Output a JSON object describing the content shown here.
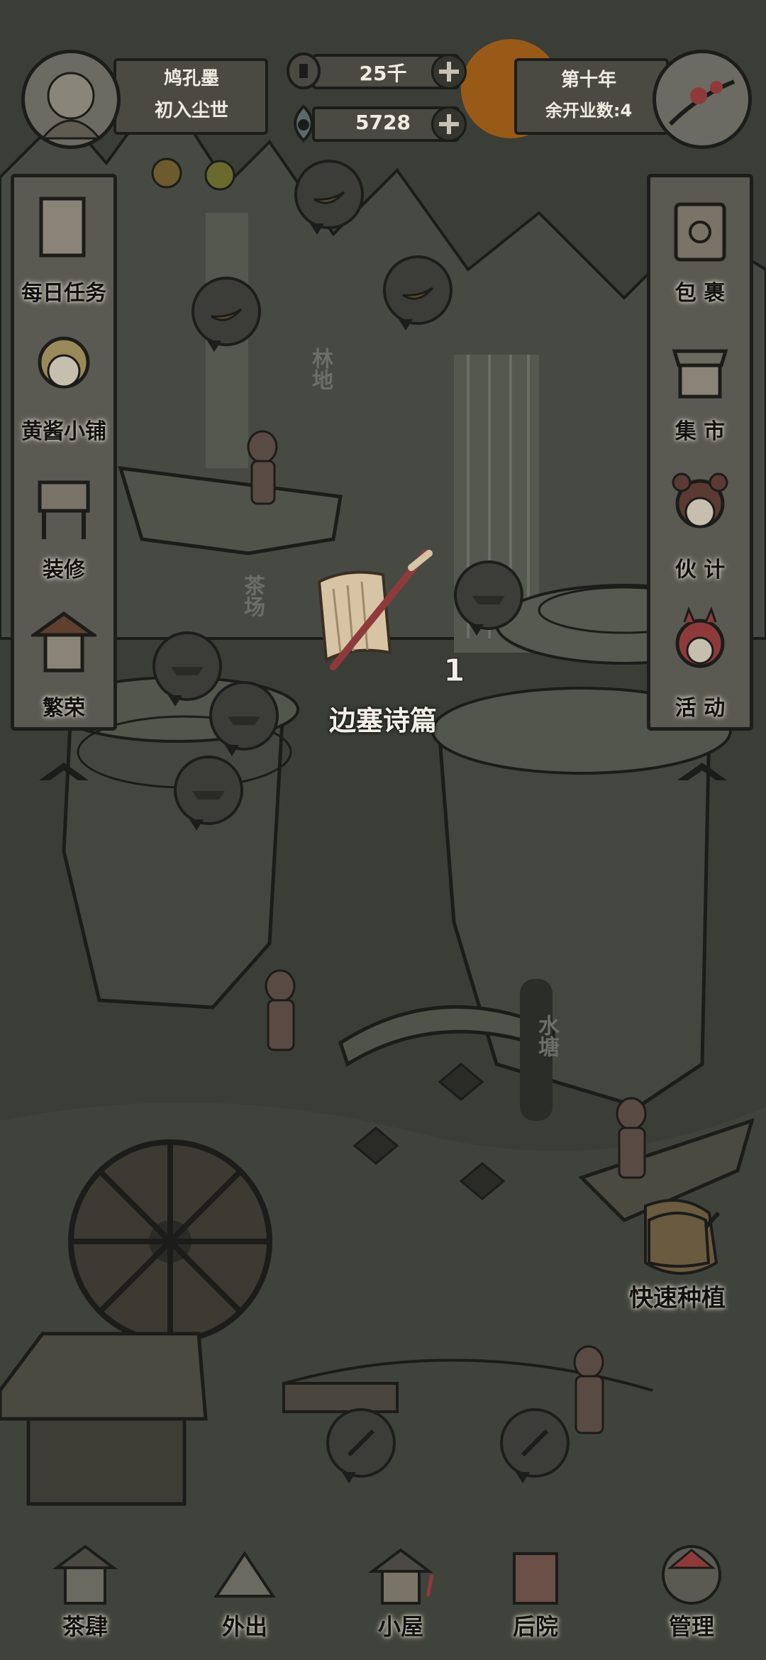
{
  "player": {
    "name": "鸠孔墨",
    "title": "初入尘世"
  },
  "currency": {
    "coins": "25千",
    "gems": "5728"
  },
  "year": {
    "label": "第十年",
    "remaining": "余开业数:4"
  },
  "left_menu": [
    {
      "label": "每日任务",
      "icon": "task-scroll-icon"
    },
    {
      "label": "黄酱小铺",
      "icon": "shop-girl-icon"
    },
    {
      "label": "装修",
      "icon": "furniture-icon"
    },
    {
      "label": "繁荣",
      "icon": "prosperity-icon"
    }
  ],
  "right_menu": [
    {
      "label": "包 裹",
      "icon": "bag-icon"
    },
    {
      "label": "集 市",
      "icon": "market-icon"
    },
    {
      "label": "伙 计",
      "icon": "clerk-icon"
    },
    {
      "label": "活 动",
      "icon": "event-icon"
    }
  ],
  "zones": {
    "forest": "林地",
    "tea_field": "茶场",
    "pond": "水塘"
  },
  "event": {
    "count": "1",
    "title": "边塞诗篇"
  },
  "quick_plant": "快速种植",
  "bottom_nav": [
    {
      "label": "茶肆",
      "icon": "teahouse-icon"
    },
    {
      "label": "外出",
      "icon": "outing-icon"
    },
    {
      "label": "小屋",
      "icon": "cottage-icon"
    },
    {
      "label": "后院",
      "icon": "backyard-icon"
    },
    {
      "label": "管理",
      "icon": "manage-icon"
    }
  ],
  "colors": {
    "background": "#3a3d36",
    "ink": "#1c1c1a",
    "sun": "#9a5a17",
    "paper": "#d6c4a4",
    "accent_red": "#8f3a3a"
  }
}
